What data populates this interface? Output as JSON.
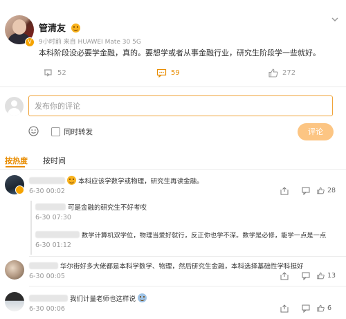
{
  "post": {
    "author": "管清友",
    "meta": "9小时前  来自 HUAWEI Mate 30 5G",
    "text": "本科阶段没必要学金融，真的。要想学或者从事金融行业，研究生阶段学一些就好。",
    "reposts": "52",
    "comments": "59",
    "likes": "272"
  },
  "composer": {
    "placeholder": "发布你的评论",
    "repost_label": "同时转发",
    "submit_label": "评论"
  },
  "tabs": {
    "hot": "按热度",
    "time": "按时间"
  },
  "comments": [
    {
      "text": "本科应该学数学或物理，研究生再读金融。",
      "time": "6-30 00:02",
      "likes": "28"
    },
    {
      "text": "华尔街好多大佬都是本科学数学、物理，然后研究生金融，本科选择基础性学科挺好",
      "time": "6-30 00:05",
      "likes": "13"
    },
    {
      "text": "我们计量老师也这样说",
      "time": "6-30 00:06",
      "likes": "6"
    }
  ],
  "replies": [
    {
      "text": "可是金融的研究生不好考哎",
      "time": "6-30 07:30"
    },
    {
      "text": "数学计算机双学位，物理当爱好就行，反正你也学不深。数学是必修，能学一点是一点",
      "time": "6-30 01:12"
    }
  ],
  "colors": {
    "accent": "#e88c00",
    "submit_bg": "#fcc583",
    "input_border": "#f0a43a"
  }
}
